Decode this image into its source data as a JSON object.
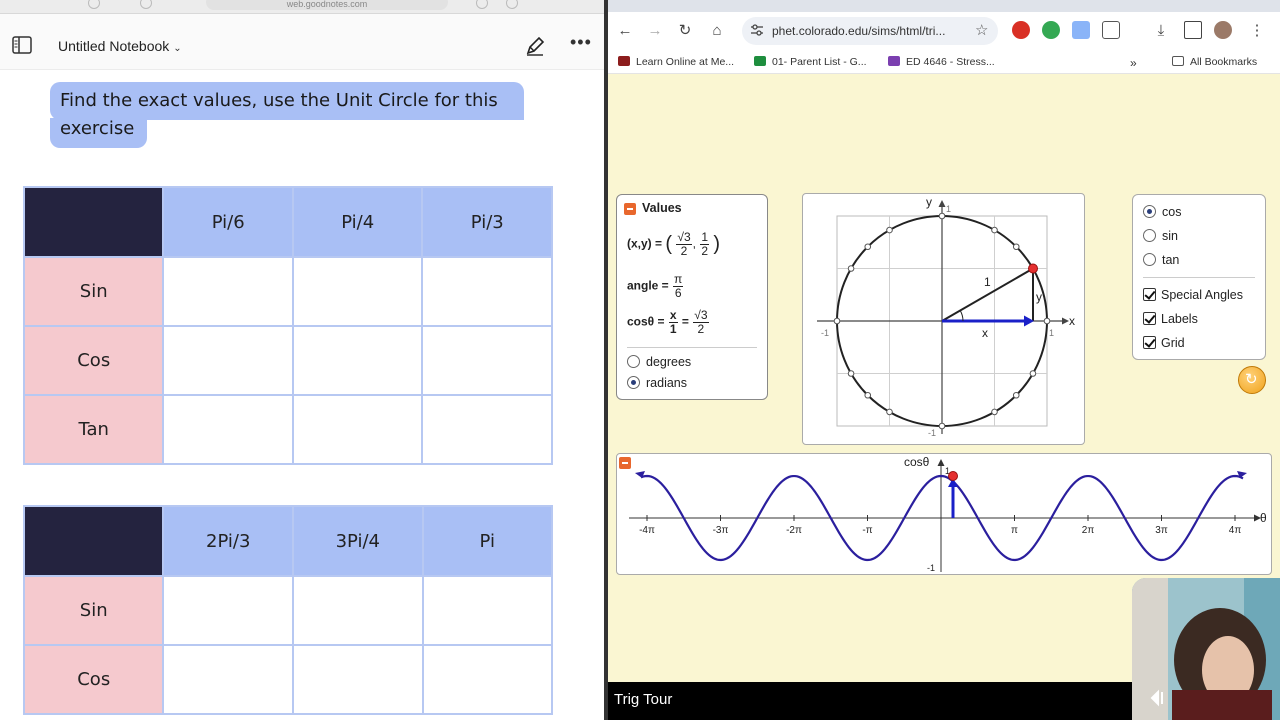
{
  "notes_app": {
    "url": "web.goodnotes.com",
    "notebook_title": "Untitled Notebook",
    "prompt": "Find the exact values, use the Unit Circle for this exercise",
    "table1": {
      "columns": [
        "Pi/6",
        "Pi/4",
        "Pi/3"
      ],
      "rows": [
        "Sin",
        "Cos",
        "Tan"
      ]
    },
    "table2": {
      "columns": [
        "2Pi/3",
        "3Pi/4",
        "Pi"
      ],
      "rows": [
        "Sin",
        "Cos"
      ]
    }
  },
  "browser": {
    "url": "phet.colorado.edu/sims/html/tri...",
    "bookmarks": [
      "Learn Online at Me...",
      "01- Parent List - G...",
      "ED 4646 - Stress...",
      "All Bookmarks"
    ],
    "colors": {
      "bookmark1": "#8c1d1d",
      "bookmark2": "#1e8e3e",
      "bookmark3": "#7b3fb0"
    }
  },
  "sim": {
    "values_panel": {
      "title": "Values",
      "xy_label": "(x,y) =",
      "xy_x_num": "√3",
      "xy_x_den": "2",
      "xy_y_num": "1",
      "xy_y_den": "2",
      "angle_label": "angle =",
      "angle_num": "π",
      "angle_den": "6",
      "cos_label": "cosθ =",
      "cos_num1": "x",
      "cos_den1": "1",
      "cos_num2": "√3",
      "cos_den2": "2",
      "degrees": "degrees",
      "radians": "radians",
      "selected_unit": "radians"
    },
    "circle": {
      "x_axis": "x",
      "y_axis": "y",
      "one_label": "1",
      "x_label": "x",
      "y_label": "y",
      "tick_pos": "1",
      "tick_neg": "-1",
      "angle": "π/6"
    },
    "options": {
      "cos": "cos",
      "sin": "sin",
      "tan": "tan",
      "selected": "cos",
      "special_angles": "Special Angles",
      "labels": "Labels",
      "grid": "Grid"
    },
    "graph": {
      "title": "cosθ",
      "theta": "θ",
      "y_top": "1",
      "y_bottom": "-1",
      "ticks": [
        "-4π",
        "-3π",
        "-2π",
        "-π",
        "π",
        "2π",
        "3π",
        "4π"
      ],
      "curve_color": "#2b1f9e",
      "marker_color": "#e53030"
    },
    "bottom_title": "Trig Tour"
  }
}
